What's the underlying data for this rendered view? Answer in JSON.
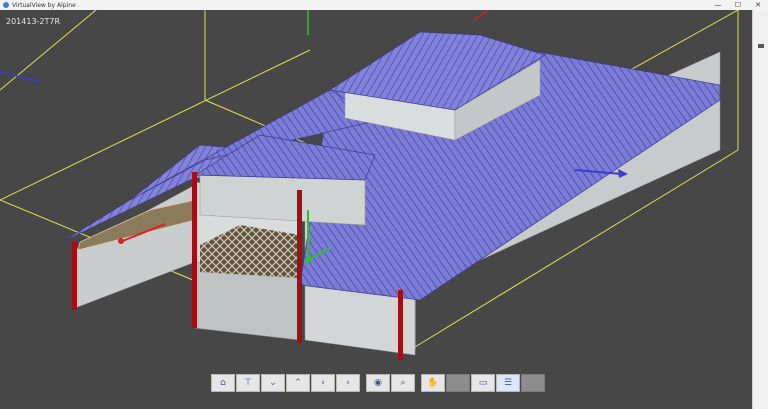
{
  "window": {
    "title": "VirtualView by Alpine",
    "minimize": "—",
    "maximize": "☐",
    "close": "✕"
  },
  "model": {
    "label": "201413-2T7R"
  },
  "toolbar": {
    "buttons": [
      {
        "icon": "home-icon",
        "glyph": "⌂"
      },
      {
        "icon": "top-view-icon",
        "glyph": "⊤"
      },
      {
        "icon": "chevron-down-icon",
        "glyph": "⌄"
      },
      {
        "icon": "chevron-up-icon",
        "glyph": "⌃"
      },
      {
        "icon": "chevron-left-icon",
        "glyph": "‹"
      },
      {
        "icon": "chevron-right-icon",
        "glyph": "›"
      },
      {
        "icon": "eye-icon",
        "glyph": "◉"
      },
      {
        "icon": "zoom-icon",
        "glyph": "⌕"
      },
      {
        "icon": "pan-hand-icon",
        "glyph": "✋"
      },
      {
        "icon": "blank-icon",
        "glyph": ""
      },
      {
        "icon": "single-layer-icon",
        "glyph": "▭"
      },
      {
        "icon": "layers-icon",
        "glyph": "☰"
      },
      {
        "icon": "blank-icon",
        "glyph": ""
      }
    ]
  },
  "colors": {
    "roof": "#7b7bd8",
    "wall": "#c7cbcb",
    "post": "#a50f14",
    "bbox": "#e0e050",
    "background": "#474747"
  }
}
